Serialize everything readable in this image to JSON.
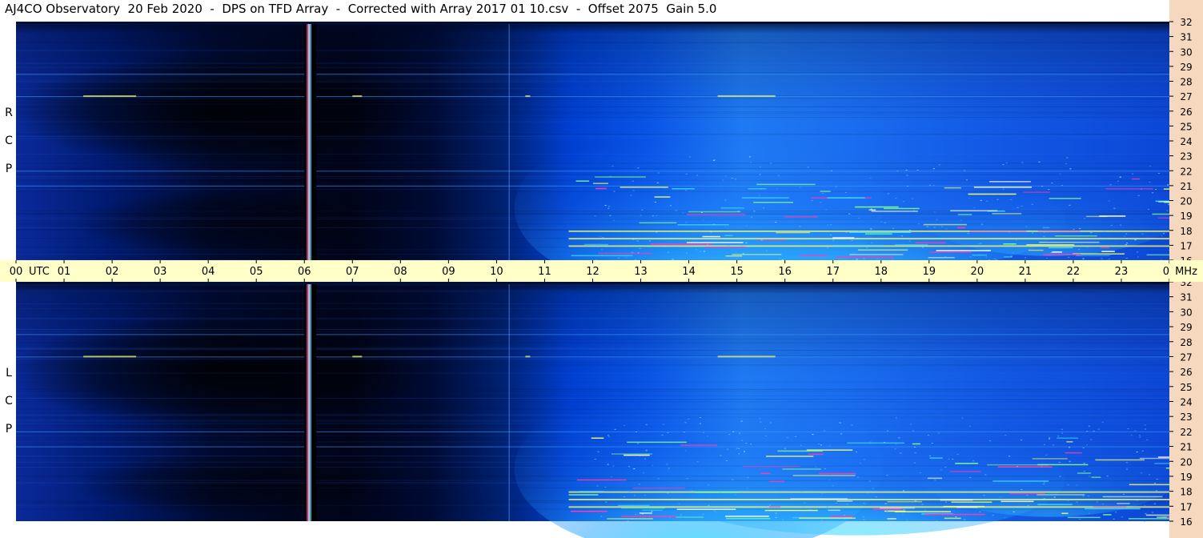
{
  "title": "AJ4CO Observatory  20 Feb 2020  -  DPS on TFD Array  -  Corrected with Array 2017 01 10.csv  -  Offset 2075  Gain 5.0",
  "panels": [
    {
      "label_letters": [
        "R",
        "C",
        "P"
      ]
    },
    {
      "label_letters": [
        "L",
        "C",
        "P"
      ]
    }
  ],
  "time_axis": {
    "ticks": [
      "00",
      "01",
      "02",
      "03",
      "04",
      "05",
      "06",
      "07",
      "08",
      "09",
      "10",
      "11",
      "12",
      "13",
      "14",
      "15",
      "16",
      "17",
      "18",
      "19",
      "20",
      "21",
      "22",
      "23",
      "00"
    ],
    "utc_label": "UTC"
  },
  "freq_axis": {
    "ticks": [
      "16",
      "17",
      "18",
      "19",
      "20",
      "21",
      "22",
      "23",
      "24",
      "25",
      "26",
      "27",
      "28",
      "29",
      "30",
      "31",
      "32"
    ],
    "unit_label": "MHz"
  },
  "colors": {
    "background": "#ffffff",
    "time_bar": "#ffffc8",
    "freq_bar": "#f6d8bf",
    "deep_blue": "#000e3a",
    "mid_blue": "#0033dd",
    "bright_blue": "#1f8cff",
    "cyan": "#3ad8ff",
    "yellow": "#f5ff6a",
    "magenta": "#ff3ab8"
  },
  "chart_data": {
    "type": "heatmap",
    "title": "AJ4CO Observatory  20 Feb 2020  -  DPS on TFD Array  -  Corrected with Array 2017 01 10.csv  -  Offset 2075  Gain 5.0",
    "xlabel": "UTC",
    "ylabel": "MHz",
    "xlim": [
      0,
      24
    ],
    "ylim": [
      16,
      32
    ],
    "x_ticks": [
      "00",
      "01",
      "02",
      "03",
      "04",
      "05",
      "06",
      "07",
      "08",
      "09",
      "10",
      "11",
      "12",
      "13",
      "14",
      "15",
      "16",
      "17",
      "18",
      "19",
      "20",
      "21",
      "22",
      "23",
      "00"
    ],
    "y_ticks": [
      16,
      17,
      18,
      19,
      20,
      21,
      22,
      23,
      24,
      25,
      26,
      27,
      28,
      29,
      30,
      31,
      32
    ],
    "panels": [
      {
        "polarization": "RCP",
        "dark_gap_hours": [
          6.0,
          6.25
        ],
        "bright_region_hours": [
          11.5,
          24
        ],
        "interference_lines_mhz": [
          17,
          17.5,
          18,
          21,
          22,
          27,
          28.5
        ]
      },
      {
        "polarization": "LCP",
        "dark_gap_hours": [
          6.0,
          6.25
        ],
        "bright_region_hours": [
          11.5,
          24
        ],
        "interference_lines_mhz": [
          17,
          17.5,
          18,
          21,
          22,
          27,
          28.5
        ]
      }
    ]
  }
}
